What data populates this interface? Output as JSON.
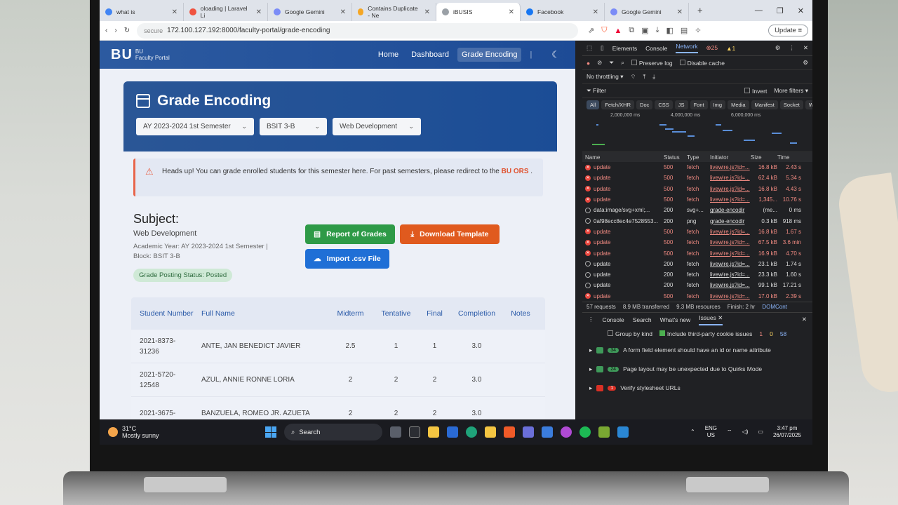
{
  "browser": {
    "tabs": [
      {
        "title": "what is",
        "color": "#4285f4"
      },
      {
        "title": "oloading | Laravel Li",
        "color": "#f05340"
      },
      {
        "title": "Google Gemini",
        "color": "#7b8cf7"
      },
      {
        "title": "Contains Duplicate - Ne",
        "color": "#f5a623"
      },
      {
        "title": "iBUSIS",
        "color": "#9aa0a6",
        "active": true
      },
      {
        "title": "Facebook",
        "color": "#1877f2"
      },
      {
        "title": "Google Gemini",
        "color": "#7b8cf7"
      }
    ],
    "new_tab": "+",
    "security": "secure",
    "url": "172.100.127.192:8000/faculty-portal/grade-encoding",
    "update_label": "Update"
  },
  "page": {
    "logo": "BU",
    "logo_sub": [
      "BU",
      "Faculty Portal"
    ],
    "nav": [
      "Home",
      "Dashboard",
      "Grade Encoding"
    ],
    "title": "Grade Encoding",
    "selects": [
      "AY 2023-2024 1st Semester",
      "BSIT 3-B",
      "Web Development"
    ],
    "alert_text": "Heads up! You can grade enrolled students for this semester here. For past semesters, please redirect to the",
    "alert_link": "BU ORS",
    "alert_end": ".",
    "subject_heading": "Subject:",
    "subject_name": "Web Development",
    "academic_year": "Academic Year: AY 2023-2024 1st Semester |",
    "block": "Block: BSIT 3-B",
    "status_badge": "Grade Posting Status: Posted",
    "btn_report": "Report of Grades",
    "btn_download": "Download Template",
    "btn_import": "Import .csv File",
    "table": {
      "headers": [
        "Student Number",
        "Full Name",
        "Midterm",
        "Tentative",
        "Final",
        "Completion",
        "Notes"
      ],
      "rows": [
        {
          "number": "2021-8373-31236",
          "name": "ANTE, JAN BENEDICT JAVIER",
          "midterm": "2.5",
          "tentative": "1",
          "final": "1",
          "completion": "3.0",
          "notes": ""
        },
        {
          "number": "2021-5720-12548",
          "name": "AZUL, ANNIE RONNE LORIA",
          "midterm": "2",
          "tentative": "2",
          "final": "2",
          "completion": "3.0",
          "notes": ""
        },
        {
          "number": "2021-3675-",
          "name": "BANZUELA, ROMEO JR. AZUETA",
          "midterm": "2",
          "tentative": "2",
          "final": "2",
          "completion": "3.0",
          "notes": ""
        }
      ]
    }
  },
  "devtools": {
    "tabs": [
      "Elements",
      "Console",
      "Network"
    ],
    "error_count": "25",
    "warning_count": "1",
    "preserve_log": "Preserve log",
    "disable_cache": "Disable cache",
    "throttling": "No throttling",
    "filter_placeholder": "Filter",
    "invert": "Invert",
    "more_filters": "More filters",
    "chips": [
      "All",
      "Fetch/XHR",
      "Doc",
      "CSS",
      "JS",
      "Font",
      "Img",
      "Media",
      "Manifest",
      "Socket",
      "W"
    ],
    "timeline_labels": [
      "2,000,000 ms",
      "4,000,000 ms",
      "6,000,000 ms"
    ],
    "columns": [
      "Name",
      "Status",
      "Type",
      "Initiator",
      "Size",
      "Time"
    ],
    "requests": [
      {
        "name": "update",
        "status": "500",
        "type": "fetch",
        "initiator": "livewire.js?id=...",
        "size": "16.8 kB",
        "time": "2.43 s",
        "error": true
      },
      {
        "name": "update",
        "status": "500",
        "type": "fetch",
        "initiator": "livewire.js?id=...",
        "size": "62.4 kB",
        "time": "5.34 s",
        "error": true
      },
      {
        "name": "update",
        "status": "500",
        "type": "fetch",
        "initiator": "livewire.js?id=...",
        "size": "16.8 kB",
        "time": "4.43 s",
        "error": true
      },
      {
        "name": "update",
        "status": "500",
        "type": "fetch",
        "initiator": "livewire.js?id=...",
        "size": "1,345...",
        "time": "10.76 s",
        "error": true
      },
      {
        "name": "data:image/svg+xml;...",
        "status": "200",
        "type": "svg+...",
        "initiator": "grade-encodir",
        "size": "(me...",
        "time": "0 ms",
        "error": false
      },
      {
        "name": "0af98ecc8ec4e7528553...",
        "status": "200",
        "type": "png",
        "initiator": "grade-encodir",
        "size": "0.3 kB",
        "time": "918 ms",
        "error": false
      },
      {
        "name": "update",
        "status": "500",
        "type": "fetch",
        "initiator": "livewire.js?id=...",
        "size": "16.8 kB",
        "time": "1.67 s",
        "error": true
      },
      {
        "name": "update",
        "status": "500",
        "type": "fetch",
        "initiator": "livewire.js?id=...",
        "size": "67.5 kB",
        "time": "3.6 min",
        "error": true
      },
      {
        "name": "update",
        "status": "500",
        "type": "fetch",
        "initiator": "livewire.js?id=...",
        "size": "16.9 kB",
        "time": "4.70 s",
        "error": true
      },
      {
        "name": "update",
        "status": "200",
        "type": "fetch",
        "initiator": "livewire.js?id=...",
        "size": "23.1 kB",
        "time": "1.74 s",
        "error": false
      },
      {
        "name": "update",
        "status": "200",
        "type": "fetch",
        "initiator": "livewire.js?id=...",
        "size": "23.3 kB",
        "time": "1.60 s",
        "error": false
      },
      {
        "name": "update",
        "status": "200",
        "type": "fetch",
        "initiator": "livewire.js?id=...",
        "size": "99.1 kB",
        "time": "17.21 s",
        "error": false
      },
      {
        "name": "update",
        "status": "500",
        "type": "fetch",
        "initiator": "livewire.js?id=...",
        "size": "17.0 kB",
        "time": "2.39 s",
        "error": true
      }
    ],
    "summary": [
      "57 requests",
      "8.9 MB transferred",
      "9.3 MB resources",
      "Finish: 2 hr",
      "DOMCont"
    ],
    "drawer_tabs": [
      "Console",
      "Search",
      "What's new",
      "Issues"
    ],
    "group_by_kind": "Group by kind",
    "third_party": "Include third-party cookie issues",
    "issue_counts": [
      "1",
      "0",
      "58"
    ],
    "issues": [
      {
        "count": "34",
        "text": "A form field element should have an id or name attribute",
        "kind": "green"
      },
      {
        "count": "24",
        "text": "Page layout may be unexpected due to Quirks Mode",
        "kind": "green"
      },
      {
        "count": "1",
        "text": "Verify stylesheet URLs",
        "kind": "red"
      }
    ]
  },
  "taskbar": {
    "temp": "31°C",
    "weather": "Mostly sunny",
    "search": "Search",
    "lang": "ENG",
    "region": "US",
    "time": "3:47 pm",
    "date": "26/07/2025"
  }
}
